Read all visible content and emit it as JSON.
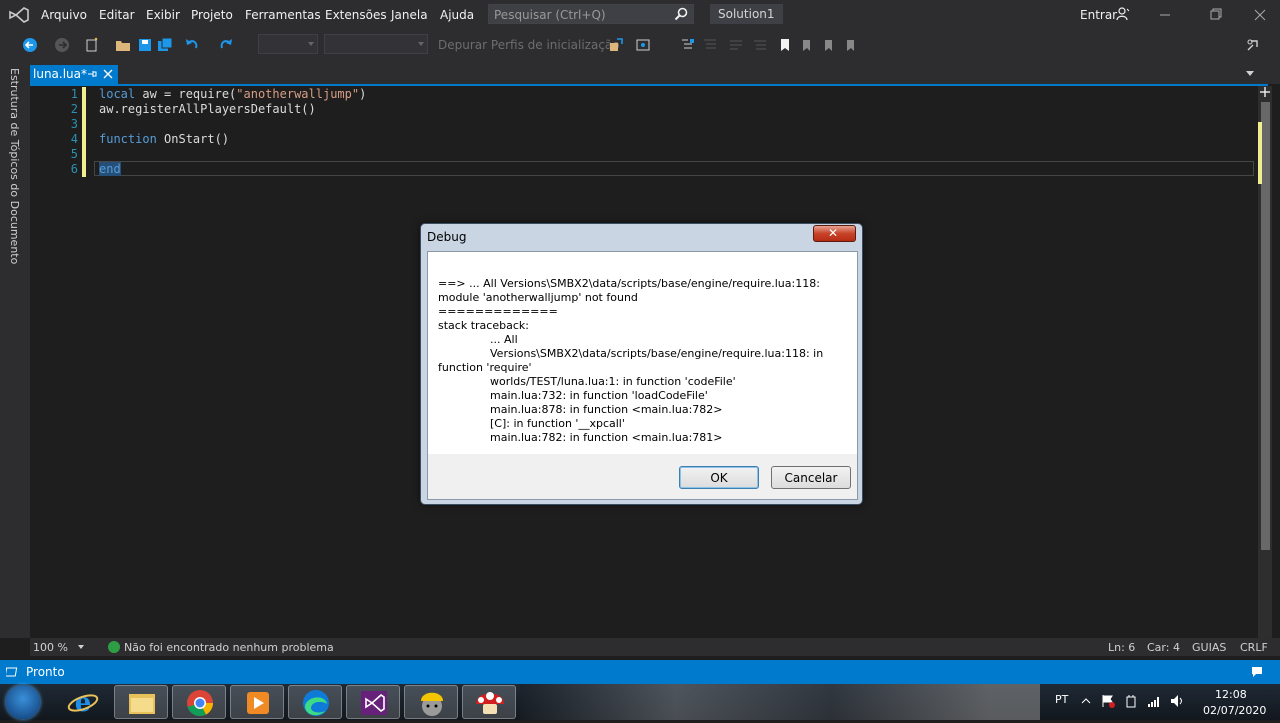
{
  "menu": {
    "items": [
      "Arquivo",
      "Editar",
      "Exibir",
      "Projeto",
      "Ferramentas",
      "Extensões",
      "Janela",
      "Ajuda"
    ],
    "search_placeholder": "Pesquisar (Ctrl+Q)",
    "solution_name": "Solution1",
    "signin": "Entrar"
  },
  "toolbar": {
    "debug_profiles": "Depurar Perfis de inicialização"
  },
  "side_panel": {
    "label": "Estrutura de Tópicos do Documento"
  },
  "tab": {
    "label": "luna.lua*"
  },
  "editor": {
    "line_numbers": [
      "1",
      "2",
      "3",
      "4",
      "5",
      "6"
    ],
    "line1_kw": "local",
    "line1_mid": " aw = require(",
    "line1_str": "\"anotherwalljump\"",
    "line1_end": ")",
    "line2": "aw.registerAllPlayersDefault()",
    "line4_kw": "function",
    "line4_rest": " OnStart()",
    "line6_kw": "end"
  },
  "editor_status": {
    "zoom": "100 %",
    "issues": "Não foi encontrado nenhum problema",
    "line": "Ln: 6",
    "col": "Car: 4",
    "tabs_mode": "GUIAS",
    "line_ending": "CRLF"
  },
  "app_status": {
    "ready": "Pronto"
  },
  "dialog": {
    "title": "Debug",
    "lines": [
      "==> ... All Versions\\SMBX2\\data/scripts/base/engine/require.lua:118: module 'anotherwalljump' not found",
      "=============",
      "stack traceback:"
    ],
    "trace1a": "... All Versions\\SMBX2\\data/scripts/base/engine/require.lua:118: in",
    "trace1b": "function 'require'",
    "trace_rest": [
      "worlds/TEST/luna.lua:1: in function 'codeFile'",
      "main.lua:732: in function 'loadCodeFile'",
      "main.lua:878: in function <main.lua:782>",
      "[C]: in function '__xpcall'",
      "main.lua:782: in function <main.lua:781>"
    ],
    "ok_label": "OK",
    "cancel_label": "Cancelar"
  },
  "taskbar": {
    "language": "PT",
    "time": "12:08",
    "date": "02/07/2020"
  },
  "colors": {
    "accent": "#007acc",
    "editor_bg": "#1e1e1e",
    "chrome_bg": "#2d2d30"
  }
}
